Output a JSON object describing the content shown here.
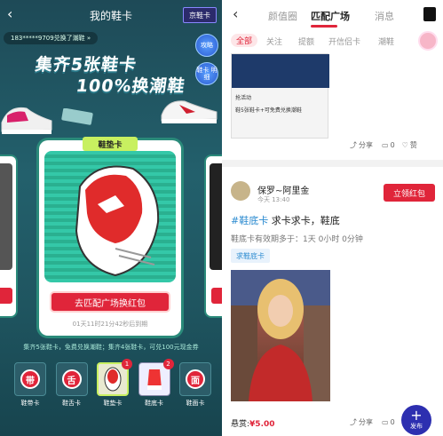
{
  "left": {
    "header": {
      "title": "我的鞋卡",
      "back": "‹",
      "brand": "京鞋卡"
    },
    "ticker": "183*****9709兑换了潮鞋 »",
    "side_buttons": [
      {
        "label": "攻略"
      },
      {
        "label": "鞋卡 明细"
      }
    ],
    "promo_line1": "集齐5张鞋卡",
    "promo_line2": "100%换潮鞋",
    "card": {
      "tag": "鞋垫卡",
      "button": "去匹配广场换红包",
      "timer": "01天11时21分42秒后到期"
    },
    "info": "集齐5张鞋卡，免费兑换潮鞋；集齐4张鞋卡，可兑100元现金券",
    "chips": [
      {
        "label": "鞋带卡",
        "glyph": "带",
        "badge": ""
      },
      {
        "label": "鞋舌卡",
        "glyph": "舌",
        "badge": ""
      },
      {
        "label": "鞋垫卡",
        "glyph": "",
        "badge": "1"
      },
      {
        "label": "鞋底卡",
        "glyph": "",
        "badge": "2"
      },
      {
        "label": "鞋面卡",
        "glyph": "面",
        "badge": ""
      }
    ]
  },
  "right": {
    "nav": {
      "back": "‹",
      "tabs": [
        "颜值圈",
        "匹配广场",
        "消息"
      ],
      "active": "匹配广场"
    },
    "subtabs": [
      "全部",
      "关注",
      "提额",
      "开信侣卡",
      "潮鞋"
    ],
    "post1": {
      "img_caption": "鞋5张鞋卡+可免费兑换潮鞋",
      "img_sub": "抢活动",
      "share": "分享",
      "comments": "0",
      "likes": "赞"
    },
    "post2": {
      "user": "保罗~阿里金",
      "time": "今天 13:40",
      "claim_button": "立领红包",
      "tag": "#鞋底卡",
      "title_rest": " 求卡求卡，鞋底",
      "desc": "鞋底卡有效期多于：1天 0小时 0分钟",
      "chip": "求鞋底卡",
      "reward_label": "悬赏:",
      "reward_amount": "¥5.00",
      "share": "分享",
      "comments": "0"
    },
    "fab": {
      "label": "发布"
    }
  }
}
